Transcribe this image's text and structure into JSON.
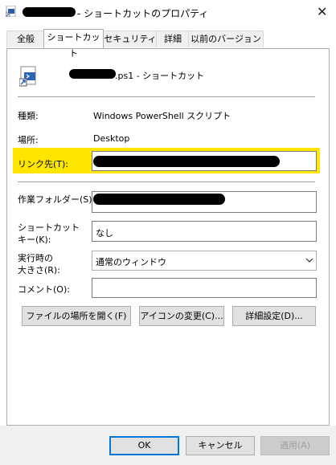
{
  "window": {
    "title_suffix": "- ショートカットのプロパティ",
    "close_glyph": "✕"
  },
  "tabs": [
    {
      "label": "全般"
    },
    {
      "label": "ショートカット"
    },
    {
      "label": "セキュリティ"
    },
    {
      "label": "詳細"
    },
    {
      "label": "以前のバージョン"
    }
  ],
  "header": {
    "file_name_suffix": ".ps1 - ショートカット"
  },
  "fields": {
    "type_label": "種類:",
    "type_value": "Windows PowerShell スクリプト",
    "location_label": "場所:",
    "location_value": "Desktop",
    "target_label": "リンク先(T):",
    "start_in_label": "作業フォルダー(S):",
    "shortcut_key_label_line1": "ショートカット",
    "shortcut_key_label_line2": "キー(K):",
    "shortcut_key_value": "なし",
    "run_label_line1": "実行時の",
    "run_label_line2": "大きさ(R):",
    "run_value": "通常のウィンドウ",
    "comment_label": "コメント(O):",
    "comment_value": ""
  },
  "buttons": {
    "open_location": "ファイルの場所を開く(F)",
    "change_icon": "アイコンの変更(C)...",
    "advanced": "詳細設定(D)...",
    "ok": "OK",
    "cancel": "キャンセル",
    "apply": "適用(A)"
  },
  "icons": {
    "title_icon": "shortcut-icon",
    "file_icon": "powershell-shortcut-icon",
    "dropdown": "chevron-down-icon"
  },
  "colors": {
    "highlight": "#ffe600",
    "ok_border": "#0078d7"
  }
}
